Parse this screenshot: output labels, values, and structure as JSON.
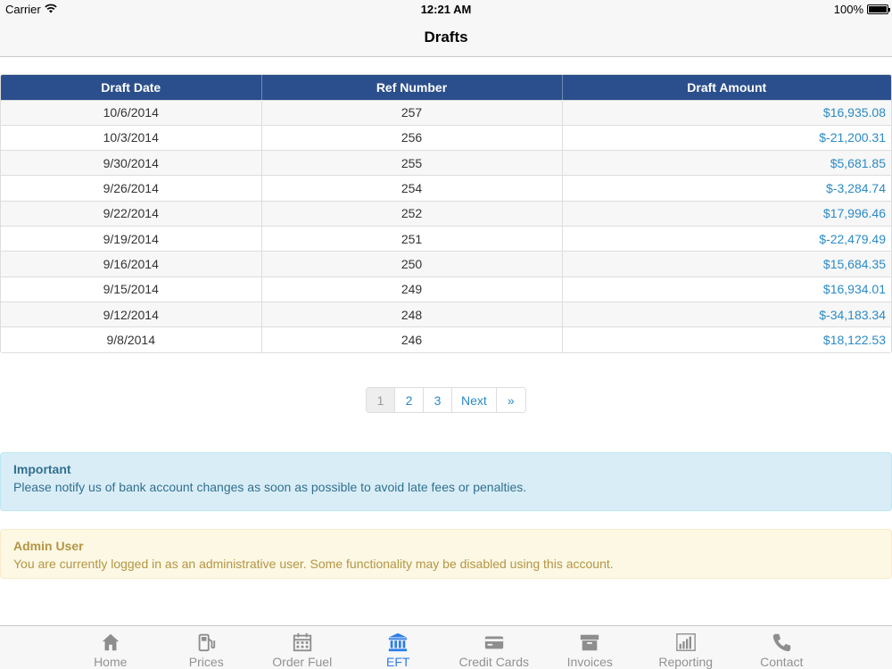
{
  "status_bar": {
    "carrier": "Carrier",
    "time": "12:21 AM",
    "battery": "100%"
  },
  "nav": {
    "title": "Drafts"
  },
  "table": {
    "headers": [
      "Draft Date",
      "Ref Number",
      "Draft Amount"
    ],
    "rows": [
      [
        "10/6/2014",
        "257",
        "$16,935.08"
      ],
      [
        "10/3/2014",
        "256",
        "$-21,200.31"
      ],
      [
        "9/30/2014",
        "255",
        "$5,681.85"
      ],
      [
        "9/26/2014",
        "254",
        "$-3,284.74"
      ],
      [
        "9/22/2014",
        "252",
        "$17,996.46"
      ],
      [
        "9/19/2014",
        "251",
        "$-22,479.49"
      ],
      [
        "9/16/2014",
        "250",
        "$15,684.35"
      ],
      [
        "9/15/2014",
        "249",
        "$16,934.01"
      ],
      [
        "9/12/2014",
        "248",
        "$-34,183.34"
      ],
      [
        "9/8/2014",
        "246",
        "$18,122.53"
      ]
    ]
  },
  "pagination": {
    "pages": [
      "1",
      "2",
      "3"
    ],
    "next": "Next",
    "last": "»",
    "active": "1"
  },
  "alerts": {
    "info": {
      "title": "Important",
      "text": "Please notify us of bank account changes as soon as possible to avoid late fees or penalties."
    },
    "warning": {
      "title": "Admin User",
      "text": "You are currently logged in as an administrative user. Some functionality may be disabled using this account."
    }
  },
  "tabs": [
    {
      "label": "Home",
      "icon": "home-icon"
    },
    {
      "label": "Prices",
      "icon": "fuel-pump-icon"
    },
    {
      "label": "Order Fuel",
      "icon": "calendar-icon"
    },
    {
      "label": "EFT",
      "icon": "bank-icon",
      "active": true
    },
    {
      "label": "Credit Cards",
      "icon": "credit-card-icon"
    },
    {
      "label": "Invoices",
      "icon": "archive-box-icon"
    },
    {
      "label": "Reporting",
      "icon": "bar-chart-icon"
    },
    {
      "label": "Contact",
      "icon": "phone-icon"
    }
  ],
  "colors": {
    "header": "#2b4f8c",
    "link": "#2a8ac6",
    "tab_active": "#2b7de9",
    "tab_inactive": "#929292"
  }
}
